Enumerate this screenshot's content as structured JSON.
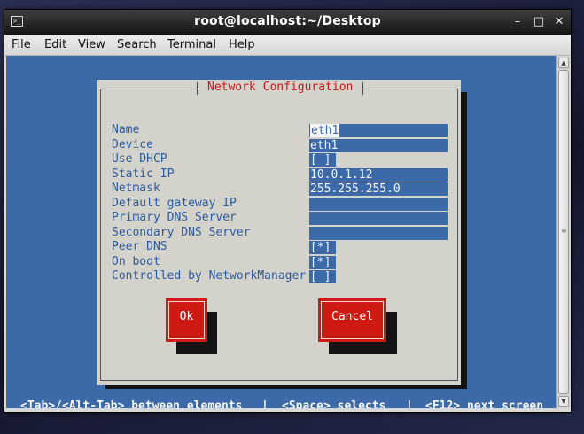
{
  "window": {
    "title": "root@localhost:~/Desktop",
    "controls": {
      "minimize": "–",
      "maximize": "□",
      "close": "✕"
    }
  },
  "menubar": [
    "File",
    "Edit",
    "View",
    "Search",
    "Terminal",
    "Help"
  ],
  "dialog": {
    "title": "Network Configuration",
    "fields": {
      "name": {
        "label": "Name",
        "value": "eth1"
      },
      "device": {
        "label": "Device",
        "value": "eth1"
      },
      "use_dhcp": {
        "label": "Use DHCP",
        "value": "[ ]"
      },
      "static_ip": {
        "label": "Static IP",
        "value": "10.0.1.12"
      },
      "netmask": {
        "label": "Netmask",
        "value": "255.255.255.0"
      },
      "default_gateway": {
        "label": "Default gateway IP",
        "value": ""
      },
      "primary_dns": {
        "label": "Primary DNS Server",
        "value": ""
      },
      "secondary_dns": {
        "label": "Secondary DNS Server",
        "value": ""
      },
      "peer_dns": {
        "label": "Peer DNS",
        "value": "[*]"
      },
      "on_boot": {
        "label": "On boot",
        "value": "[*]"
      },
      "nm_controlled": {
        "label": "Controlled by NetworkManager",
        "value": "[ ]"
      }
    },
    "buttons": {
      "ok": "Ok",
      "cancel": "Cancel"
    }
  },
  "status": {
    "tab": "<Tab>/<Alt-Tab> between elements",
    "space": "<Space> selects",
    "f12": "<F12> next screen",
    "separator": "|"
  },
  "colors": {
    "terminal_bg": "#3c6aa8",
    "dialog_bg": "#d3d3cc",
    "label": "#2c5aa0",
    "title": "#c81515",
    "button": "#cf1a14"
  }
}
